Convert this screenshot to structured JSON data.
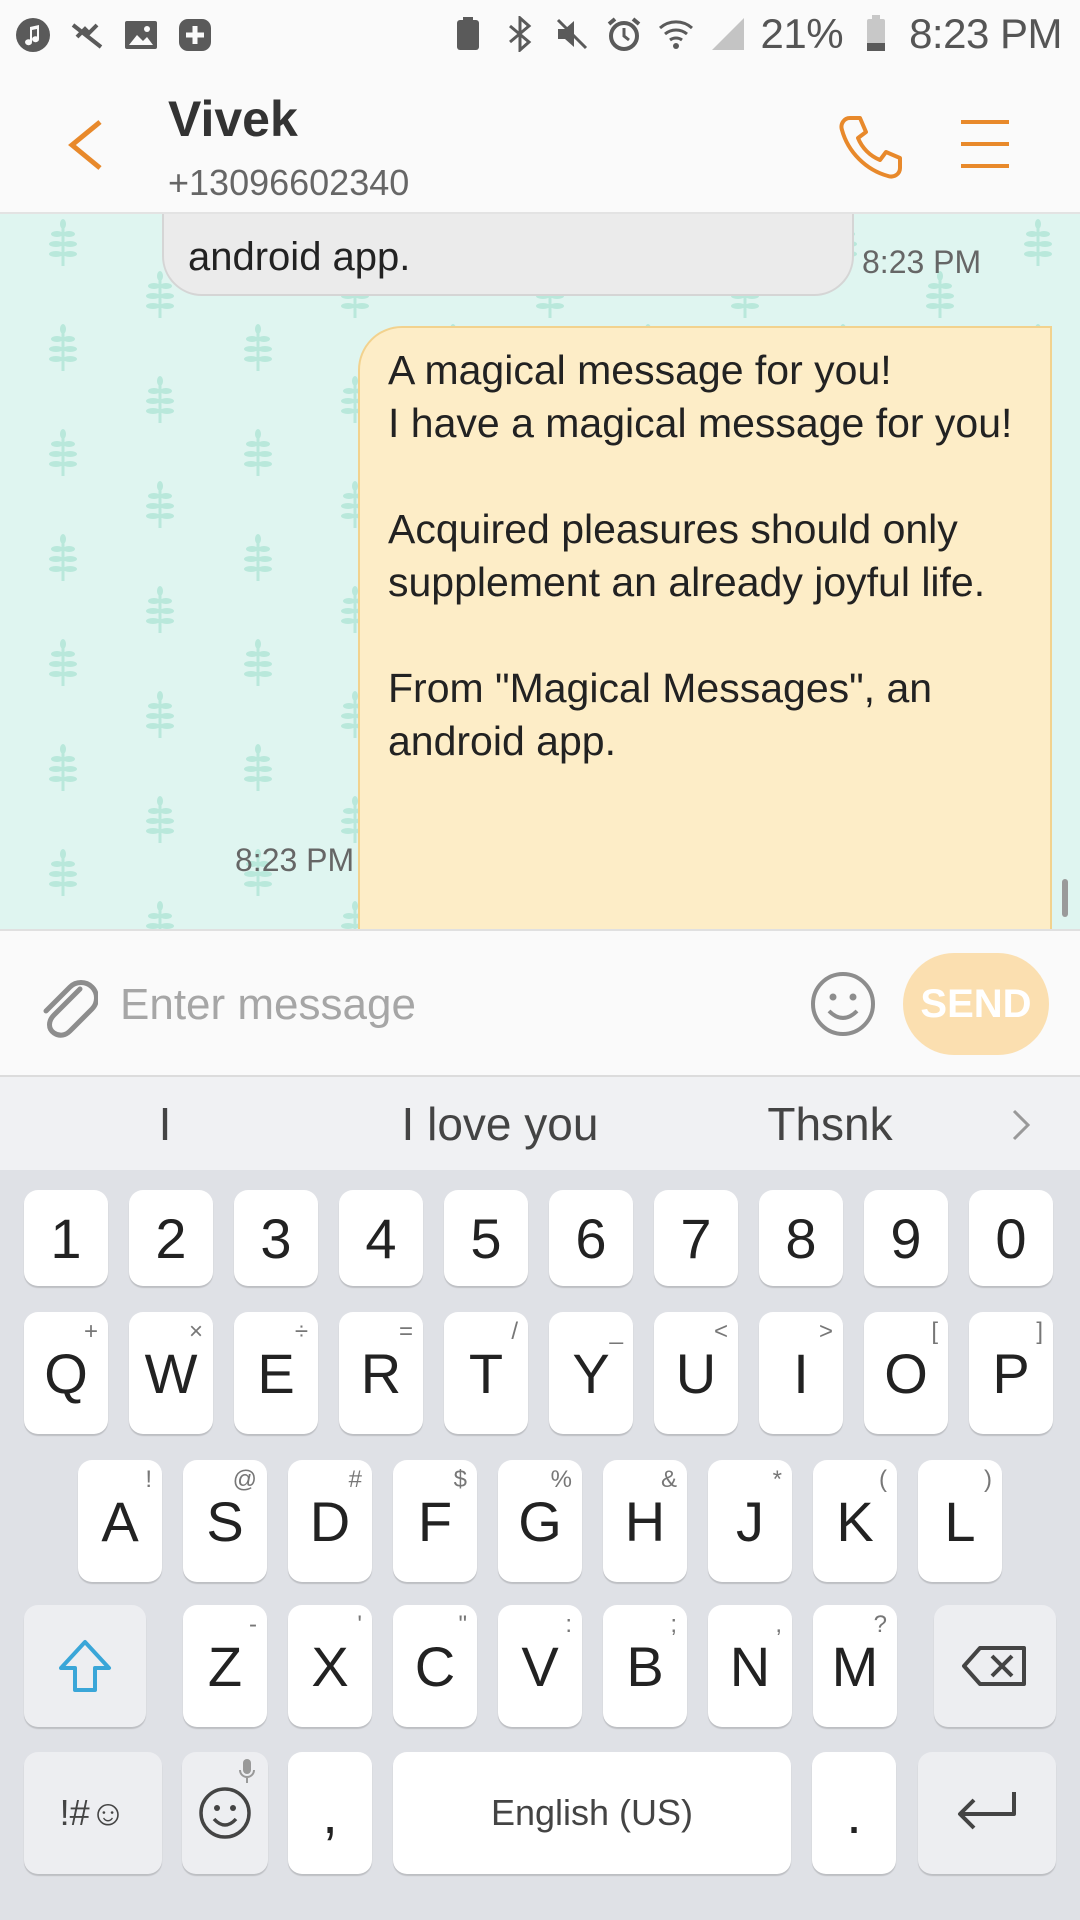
{
  "status_bar": {
    "battery": "21%",
    "time": "8:23 PM"
  },
  "header": {
    "contact_name": "Vivek",
    "contact_number": "+13096602340"
  },
  "conversation": {
    "incoming_text": "android app.",
    "incoming_time": "8:23 PM",
    "outgoing_lines": [
      "A magical message for you!",
      "I have a magical message for you!",
      "",
      "Acquired pleasures should only supplement an already joyful life.",
      "",
      "From \"Magical Messages\", an android app."
    ],
    "outgoing_time": "8:23 PM"
  },
  "compose": {
    "placeholder": "Enter message",
    "send_label": "SEND"
  },
  "suggestions": [
    "I",
    "I love you",
    "Thsnk"
  ],
  "keyboard": {
    "number_row": [
      "1",
      "2",
      "3",
      "4",
      "5",
      "6",
      "7",
      "8",
      "9",
      "0"
    ],
    "row1": [
      {
        "key": "Q",
        "sub": "+"
      },
      {
        "key": "W",
        "sub": "×"
      },
      {
        "key": "E",
        "sub": "÷"
      },
      {
        "key": "R",
        "sub": "="
      },
      {
        "key": "T",
        "sub": "/"
      },
      {
        "key": "Y",
        "sub": "_"
      },
      {
        "key": "U",
        "sub": "<"
      },
      {
        "key": "I",
        "sub": ">"
      },
      {
        "key": "O",
        "sub": "["
      },
      {
        "key": "P",
        "sub": "]"
      }
    ],
    "row2": [
      {
        "key": "A",
        "sub": "!"
      },
      {
        "key": "S",
        "sub": "@"
      },
      {
        "key": "D",
        "sub": "#"
      },
      {
        "key": "F",
        "sub": "$"
      },
      {
        "key": "G",
        "sub": "%"
      },
      {
        "key": "H",
        "sub": "&"
      },
      {
        "key": "J",
        "sub": "*"
      },
      {
        "key": "K",
        "sub": "("
      },
      {
        "key": "L",
        "sub": ")"
      }
    ],
    "row3": [
      {
        "key": "Z",
        "sub": "-"
      },
      {
        "key": "X",
        "sub": "'"
      },
      {
        "key": "C",
        "sub": "\""
      },
      {
        "key": "V",
        "sub": ":"
      },
      {
        "key": "B",
        "sub": ";"
      },
      {
        "key": "N",
        "sub": ","
      },
      {
        "key": "M",
        "sub": "?"
      }
    ],
    "symbols_label": "!#☺",
    "comma": ",",
    "space_label": "English (US)",
    "period": "."
  },
  "colors": {
    "accent": "#e8892b",
    "conversation_bg": "#dff5f0",
    "outgoing_bubble": "#fdedc7",
    "send_button": "#fbdfb0"
  }
}
